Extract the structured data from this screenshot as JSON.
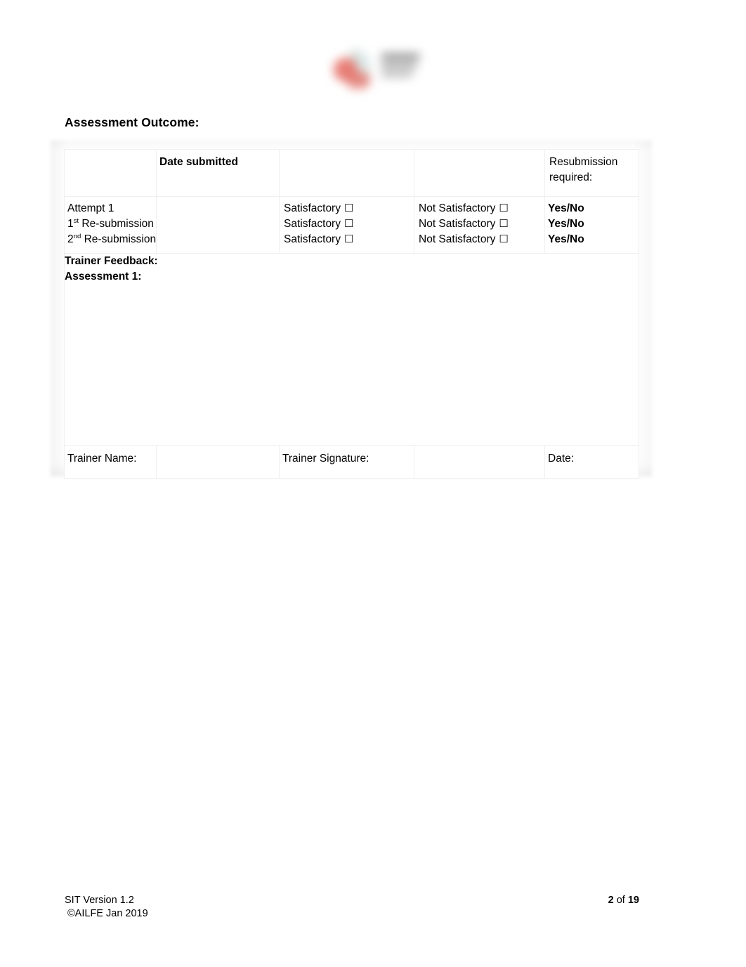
{
  "document": {
    "heading": "Assessment Outcome:"
  },
  "logo": {
    "name": "organisation-logo"
  },
  "table": {
    "header": {
      "col_attempt": "",
      "col_date_submitted": "Date submitted",
      "col_satisfactory": "",
      "col_not_satisfactory": "",
      "col_resubmission": "Resubmission required:"
    },
    "rows": [
      {
        "attempt": "Attempt 1",
        "attempt_ordinal": "",
        "attempt_sup": "",
        "date_submitted": "",
        "satisfactory_label": "Satisfactory",
        "satisfactory_checkbox": "☐",
        "not_satisfactory_label": "Not Satisfactory",
        "not_satisfactory_checkbox": "☐",
        "resubmission": "Yes/No"
      },
      {
        "attempt": "",
        "attempt_ordinal": "1",
        "attempt_sup": "st",
        "attempt_rest": "  Re-submission",
        "date_submitted": "",
        "satisfactory_label": "Satisfactory",
        "satisfactory_checkbox": "☐",
        "not_satisfactory_label": "Not Satisfactory",
        "not_satisfactory_checkbox": "☐",
        "resubmission": "Yes/No"
      },
      {
        "attempt": "",
        "attempt_ordinal": "2",
        "attempt_sup": "nd",
        "attempt_rest": " Re-submission",
        "date_submitted": "",
        "satisfactory_label": "Satisfactory",
        "satisfactory_checkbox": "☐",
        "not_satisfactory_label": "Not Satisfactory",
        "not_satisfactory_checkbox": "☐",
        "resubmission": "Yes/No"
      }
    ],
    "feedback": {
      "label_line1": "Trainer Feedback:",
      "label_line2": "Assessment 1:",
      "value": ""
    },
    "signature_row": {
      "trainer_name_label": "Trainer Name:",
      "trainer_name_value": "",
      "trainer_signature_label": "Trainer Signature:",
      "trainer_signature_value": "",
      "date_label": "Date:",
      "date_value": ""
    }
  },
  "footer": {
    "version": "SIT Version 1.2",
    "copyright": "©AILFE Jan 2019",
    "page_current": "2",
    "page_of": " of ",
    "page_total": "19"
  }
}
